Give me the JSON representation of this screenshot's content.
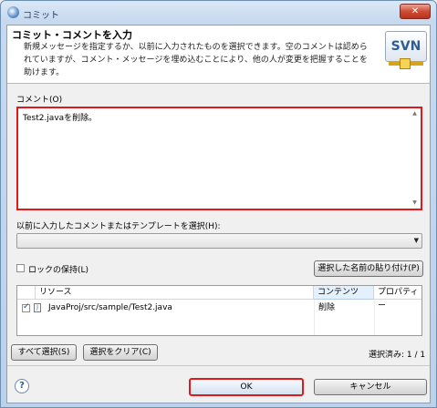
{
  "window": {
    "title": "コミット",
    "close_label": "✕"
  },
  "header": {
    "title": "コミット・コメントを入力",
    "description": "新規メッセージを指定するか、以前に入力されたものを選択できます。空のコメントは認められていますが、コメント・メッセージを埋め込むことにより、他の人が変更を把握することを助けます。",
    "logo_text": "SVN"
  },
  "comment": {
    "label": "コメント(O)",
    "value": "Test2.javaを削除。"
  },
  "template": {
    "label": "以前に入力したコメントまたはテンプレートを選択(H):",
    "selected": ""
  },
  "options": {
    "keep_locks_label": "ロックの保持(L)",
    "keep_locks_checked": false,
    "paste_names_label": "選択した名前の貼り付け(P)"
  },
  "table": {
    "columns": [
      "リソース",
      "コンテンツ",
      "プロパティー"
    ],
    "rows": [
      {
        "checked": true,
        "resource": "JavaProj/src/sample/Test2.java",
        "content": "削除",
        "properties": ""
      }
    ]
  },
  "selection": {
    "select_all_label": "すべて選択(S)",
    "clear_label": "選択をクリア(C)",
    "count_text": "選択済み: 1 / 1"
  },
  "footer": {
    "ok_label": "OK",
    "cancel_label": "キャンセル",
    "help_label": "?"
  }
}
